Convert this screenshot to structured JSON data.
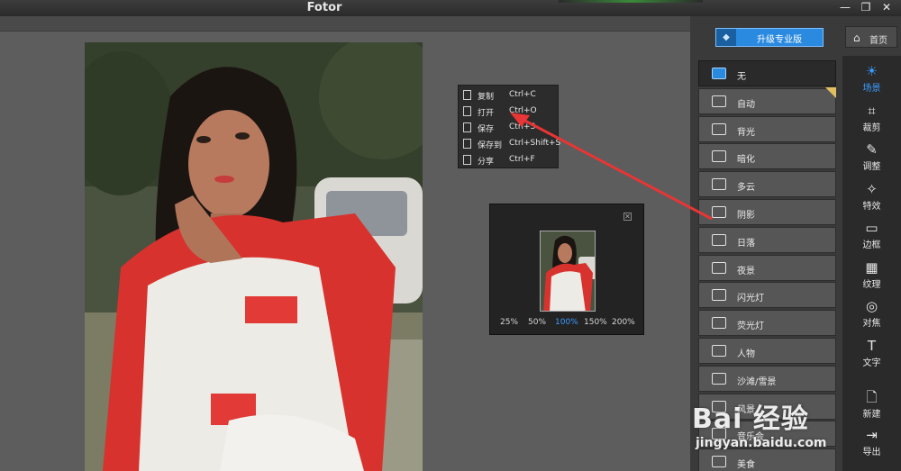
{
  "window": {
    "title": "Fotor",
    "min": "—",
    "restore": "❐",
    "close": "✕"
  },
  "popup_menu": [
    {
      "label": "复制",
      "shortcut": "Ctrl+C",
      "icon": "copy-icon"
    },
    {
      "label": "打开",
      "shortcut": "Ctrl+O",
      "icon": "open-file-icon"
    },
    {
      "label": "保存",
      "shortcut": "Ctrl+S",
      "icon": "save-icon"
    },
    {
      "label": "保存到",
      "shortcut": "Ctrl+Shift+S",
      "icon": "save-to-icon"
    },
    {
      "label": "分享",
      "shortcut": "Ctrl+F",
      "icon": "share-icon"
    }
  ],
  "navigator": {
    "close": "✕",
    "zoom_levels": [
      "25%",
      "50%",
      "100%",
      "150%",
      "200%"
    ],
    "active_zoom": "100%"
  },
  "header": {
    "upgrade_label": "升级专业版",
    "upgrade_icon": "◆",
    "home_label": "首页",
    "home_icon": "⌂"
  },
  "scenes": [
    {
      "label": "无",
      "icon": "none-icon",
      "selected": true
    },
    {
      "label": "自动",
      "icon": "auto-icon"
    },
    {
      "label": "背光",
      "icon": "backlight-icon"
    },
    {
      "label": "暗化",
      "icon": "darken-icon"
    },
    {
      "label": "多云",
      "icon": "cloudy-icon"
    },
    {
      "label": "阴影",
      "icon": "shade-icon"
    },
    {
      "label": "日落",
      "icon": "sunset-icon"
    },
    {
      "label": "夜景",
      "icon": "night-icon"
    },
    {
      "label": "闪光灯",
      "icon": "flash-icon"
    },
    {
      "label": "荧光灯",
      "icon": "fluorescent-icon"
    },
    {
      "label": "人物",
      "icon": "portrait-icon"
    },
    {
      "label": "沙滩/雪景",
      "icon": "beach-snow-icon"
    },
    {
      "label": "风景",
      "icon": "landscape-icon"
    },
    {
      "label": "音乐会",
      "icon": "concert-icon"
    },
    {
      "label": "美食",
      "icon": "food-icon"
    }
  ],
  "tools": [
    {
      "label": "场景",
      "icon": "☀",
      "active": true
    },
    {
      "label": "裁剪",
      "icon": "⌗"
    },
    {
      "label": "调整",
      "icon": "✎"
    },
    {
      "label": "特效",
      "icon": "✧"
    },
    {
      "label": "边框",
      "icon": "▭"
    },
    {
      "label": "纹理",
      "icon": "▦"
    },
    {
      "label": "对焦",
      "icon": "◎"
    },
    {
      "label": "文字",
      "icon": "T"
    },
    {
      "label": "新建",
      "icon": "🗋"
    },
    {
      "label": "导出",
      "icon": "⇥"
    }
  ],
  "watermark": {
    "brand": "Bai 经验",
    "url": "jingyan.baidu.com"
  },
  "colors": {
    "accent": "#2a8ae0",
    "active_text": "#3a9cff",
    "arrow": "#e83535"
  }
}
